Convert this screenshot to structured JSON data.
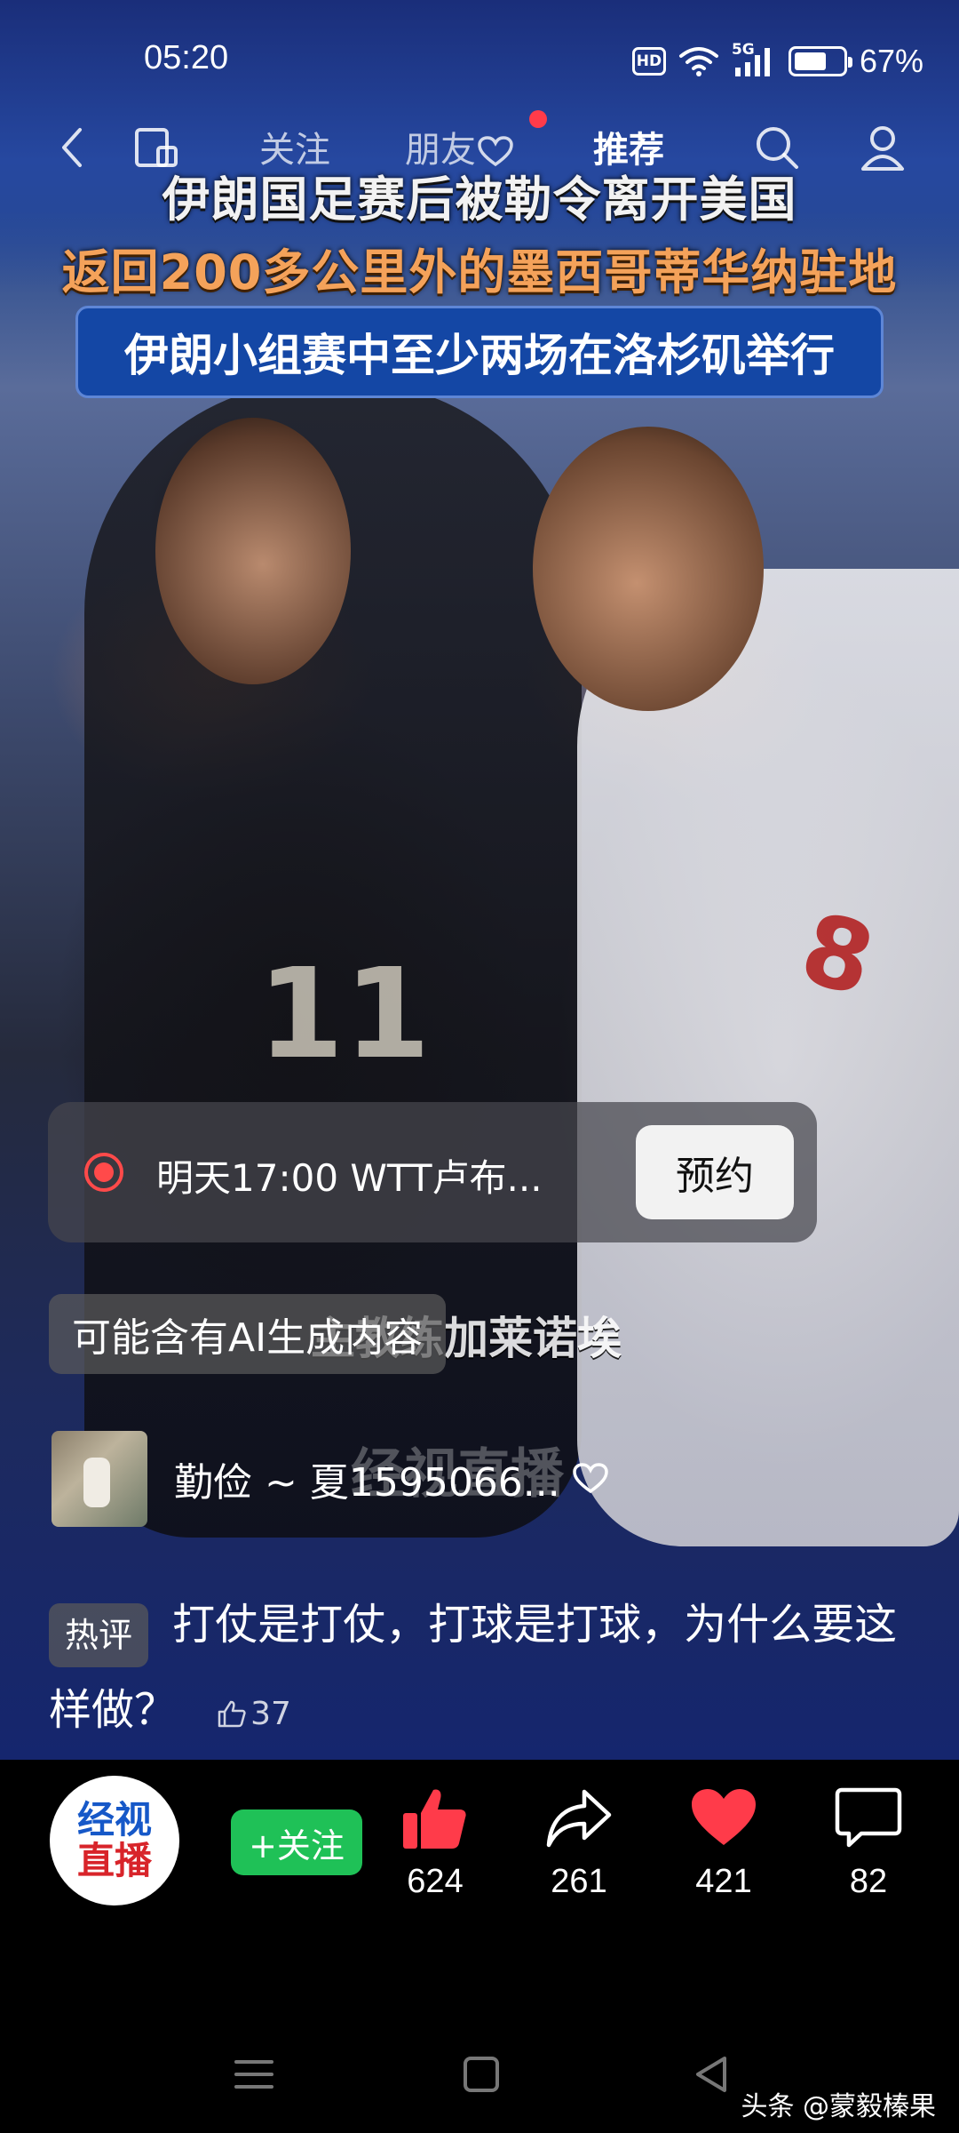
{
  "status_bar": {
    "time": "05:20",
    "hd_label": "HD",
    "network": "5G",
    "battery_percent": "67%",
    "battery_level": 0.67
  },
  "nav": {
    "tabs": [
      {
        "label": "关注",
        "active": false
      },
      {
        "label": "朋友",
        "active": false,
        "has_heart": true,
        "has_dot": true
      },
      {
        "label": "推荐",
        "active": true
      }
    ]
  },
  "video": {
    "headline_1": "伊朗国足赛后被勒令离开美国",
    "headline_2": "返回200多公里外的墨西哥蒂华纳驻地",
    "headline_3": "伊朗小组赛中至少两场在洛杉矶举行",
    "jersey_left": "11",
    "jersey_right": "8",
    "subtitle_caption": "主教练加莱诺埃",
    "watermark": "经视直播"
  },
  "reserve_card": {
    "text": "明天17:00 WTT卢布...",
    "button_label": "预约"
  },
  "ai_notice": "可能含有AI生成内容",
  "top_comment": {
    "user_name": "勤俭 ~ 夏1595066...",
    "tag": "热评",
    "text": "打仗是打仗，打球是打球，为什么要这样做？",
    "likes": "37"
  },
  "channel": {
    "logo_line_1": "经视",
    "logo_line_2": "直播",
    "follow_label": "+关注"
  },
  "actions": {
    "like_count": "624",
    "share_count": "261",
    "favorite_count": "421",
    "comment_count": "82"
  },
  "footer_credit": "头条 @蒙毅榛果",
  "colors": {
    "follow_green": "#1fc157",
    "like_red": "#ff3b4a",
    "headline_orange": "#f4a25a",
    "headline_box_blue": "#1447a5"
  }
}
